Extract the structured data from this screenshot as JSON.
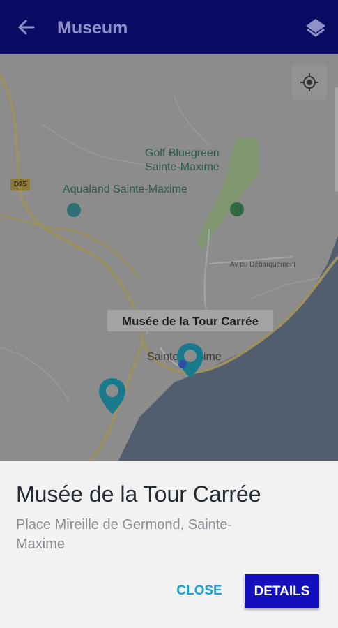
{
  "app_bar": {
    "title": "Museum",
    "background": "#0c0b63",
    "back_icon": "arrow-back-icon",
    "layers_icon": "layers-icon"
  },
  "map": {
    "road_badge": "D25",
    "labels": {
      "golf_line1": "Golf Bluegreen",
      "golf_line2": "Sainte-Maxime",
      "aqualand": "Aqualand Sainte-Maxime",
      "street": "Av du Débarquement",
      "town": "Sainte-Maxime"
    },
    "info_window": "Musée de la Tour Carrée",
    "locate_icon": "my-location-icon",
    "marker_color": "#187a8c"
  },
  "bottom_sheet": {
    "title": "Musée de la Tour Carrée",
    "address": "Place Mireille de Germond, Sainte-Maxime",
    "close_label": "CLOSE",
    "details_label": "DETAILS",
    "close_color": "#1aa3d8",
    "details_color": "#140fbd"
  }
}
